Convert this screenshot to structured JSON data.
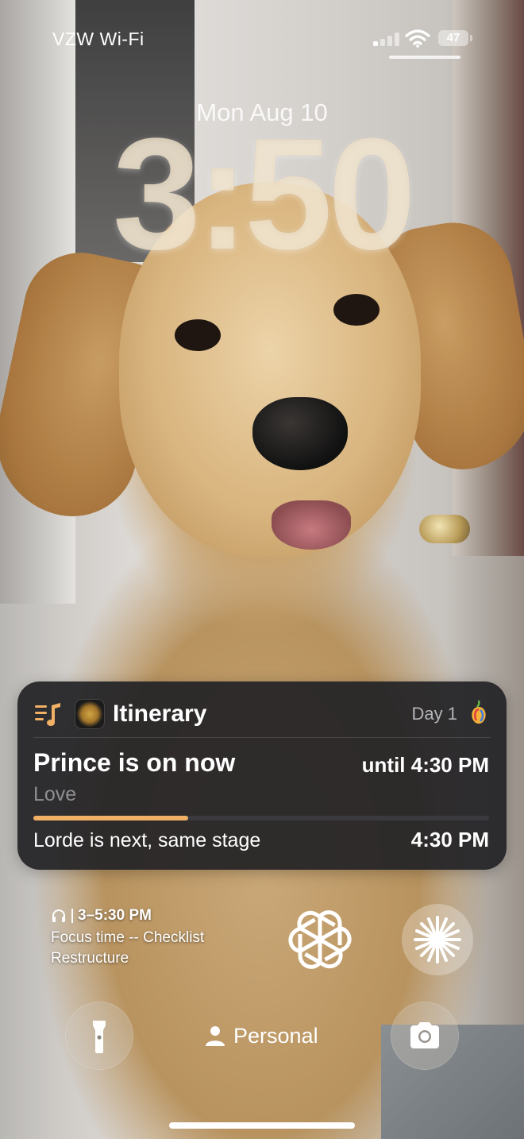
{
  "status_bar": {
    "carrier": "VZW Wi-Fi",
    "battery": "47",
    "signal_bars_active": 1
  },
  "lock_screen": {
    "date": "Mon Aug 10",
    "time": "3:50"
  },
  "live_activity": {
    "app_title": "Itinerary",
    "day_label": "Day 1",
    "now_playing": "Prince is on now",
    "until": "until 4:30 PM",
    "song": "Love",
    "progress_fraction": 0.34,
    "next_text": "Lorde is next, same stage",
    "next_time": "4:30 PM",
    "accent_color": "#f0b065",
    "icons": {
      "list": "playlist-icon",
      "app": "app-icon",
      "corner": "fruit-icon"
    }
  },
  "focus_widget": {
    "time_range": "3–5:30 PM",
    "title": "Focus time -- Checklist Restructure",
    "icon": "headphones-icon"
  },
  "widgets": [
    "chatgpt-icon",
    "spark-icon"
  ],
  "bottom": {
    "focus_mode": "Personal",
    "left_button_icon": "flashlight-icon",
    "right_button_icon": "camera-icon"
  }
}
